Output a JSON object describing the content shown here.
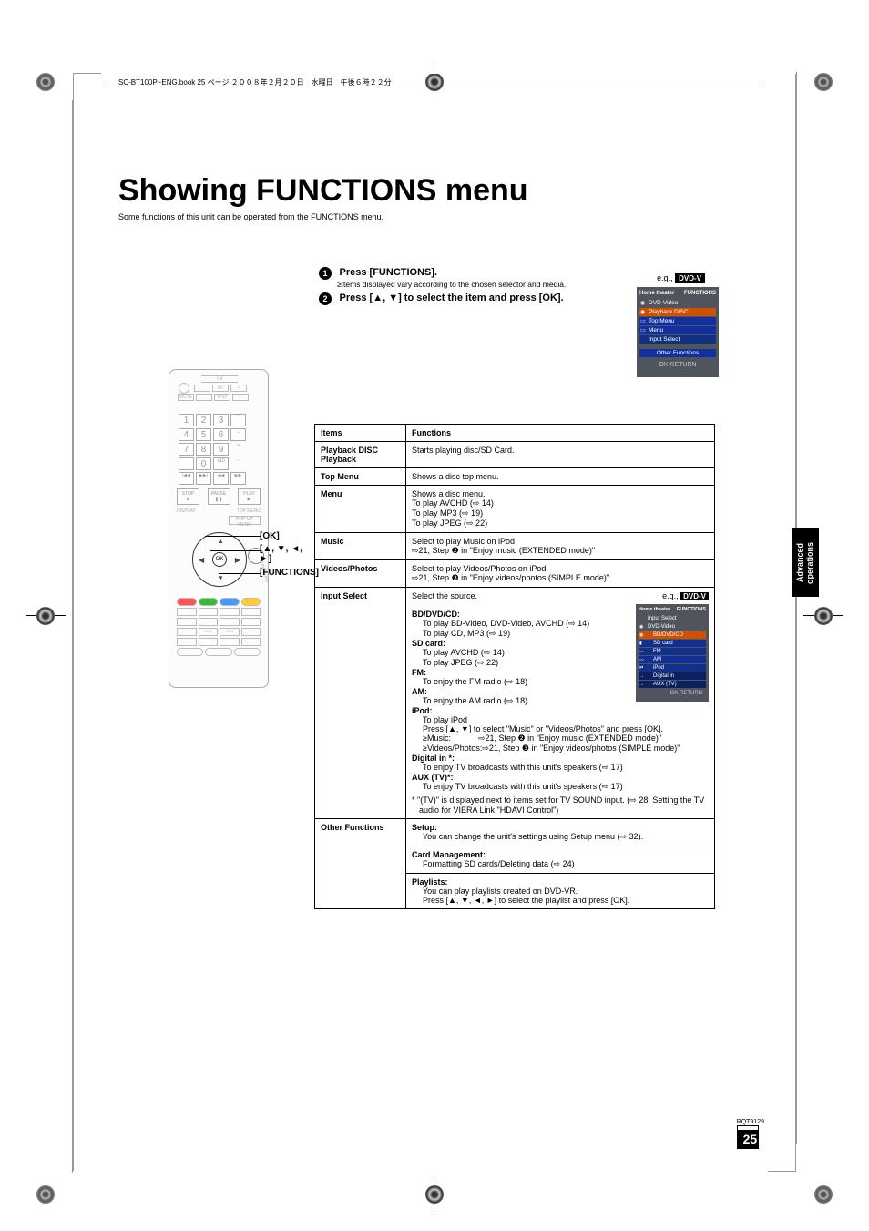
{
  "header_line": "SC-BT100P~ENG.book  25 ページ  ２００８年２月２０日　水曜日　午後６時２２分",
  "title": "Showing FUNCTIONS menu",
  "subtitle": "Some functions of this unit can be operated from the FUNCTIONS menu.",
  "steps": [
    {
      "num": "1",
      "text": "Press [FUNCTIONS].",
      "note": "≥Items displayed vary according to the chosen selector and media."
    },
    {
      "num": "2",
      "text": "Press [▲, ▼] to select the item and press [OK].",
      "note": ""
    }
  ],
  "eg_prefix": "e.g., ",
  "eg_label": "DVD-V",
  "osd1": {
    "left": "Home theater",
    "right": "FUNCTIONS",
    "title": "DVD-Video",
    "items": [
      "Playback DISC",
      "Top Menu",
      "Menu",
      "Input Select"
    ],
    "other": "Other Functions",
    "foot": "OK RETURN"
  },
  "remote_labels": {
    "ok": "[OK]",
    "arrows": "[▲, ▼, ◄, ►]",
    "functions": "[FUNCTIONS]"
  },
  "table": {
    "head": [
      "Items",
      "Functions"
    ],
    "rows": [
      {
        "item": "Playback DISC\nPlayback",
        "func": "Starts playing disc/SD Card."
      },
      {
        "item": "Top Menu",
        "func": "Shows a disc top menu."
      },
      {
        "item": "Menu",
        "func_lines": [
          "Shows a disc menu.",
          "To play AVCHD (⇨ 14)",
          "To play MP3 (⇨ 19)",
          "To play JPEG (⇨ 22)"
        ]
      },
      {
        "item": "Music",
        "func_lines": [
          "Select to play Music on iPod",
          "⇨21, Step ❷ in \"Enjoy music (EXTENDED mode)\""
        ]
      },
      {
        "item": "Videos/Photos",
        "func_lines": [
          "Select to play Videos/Photos on iPod",
          "⇨21, Step ❸ in \"Enjoy videos/photos (SIMPLE mode)\""
        ]
      },
      {
        "item": "Input Select",
        "selectline": "Select the source.",
        "eg": "e.g., ",
        "eglabel": "DVD-V",
        "osd2": {
          "left": "Home theater",
          "right": "FUNCTIONS",
          "title": "Input Select",
          "sub": "DVD-Video",
          "items": [
            "BD/DVD/CD",
            "SD card",
            "FM",
            "AM",
            "iPod",
            "Digital in",
            "AUX (TV)"
          ],
          "foot": "OK RETURN"
        },
        "groups": [
          {
            "head": "BD/DVD/CD:",
            "lines": [
              "To play BD-Video, DVD-Video, AVCHD (⇨ 14)",
              "To play CD, MP3 (⇨ 19)"
            ]
          },
          {
            "head": "SD card:",
            "lines": [
              "To play AVCHD (⇨ 14)",
              "To play JPEG (⇨ 22)"
            ]
          },
          {
            "head": "FM:",
            "lines": [
              "To enjoy the FM radio (⇨ 18)"
            ]
          },
          {
            "head": "AM:",
            "lines": [
              "To enjoy the AM radio (⇨ 18)"
            ]
          },
          {
            "head": "iPod:",
            "lines": [
              "To play iPod",
              "Press [▲, ▼] to select \"Music\" or \"Videos/Photos\" and press [OK].",
              "≥Music:            ⇨21, Step ❷ in \"Enjoy music (EXTENDED mode)\"",
              "≥Videos/Photos:⇨21, Step ❸ in \"Enjoy videos/photos (SIMPLE mode)\""
            ]
          },
          {
            "head": "Digital in *:",
            "lines": [
              "To enjoy TV broadcasts with this unit's speakers (⇨ 17)"
            ]
          },
          {
            "head": "AUX (TV)*:",
            "lines": [
              "To enjoy TV broadcasts with this unit's speakers (⇨ 17)"
            ]
          }
        ],
        "footnote": "* \"(TV)\" is displayed next to items set for TV SOUND input. (⇨ 28, Setting the TV audio for VIERA Link \"HDAVI Control\")"
      },
      {
        "item": "Other Functions",
        "subrows": [
          {
            "head": "Setup:",
            "line": "You can change the unit's settings using Setup menu (⇨ 32)."
          },
          {
            "head": "Card Management:",
            "line": "Formatting SD cards/Deleting data (⇨ 24)"
          },
          {
            "head": "Playlists:",
            "line": "You can play playlists created on DVD-VR.\nPress [▲, ▼, ◄, ►] to select the playlist and press [OK]."
          }
        ]
      }
    ]
  },
  "sidebar": "Advanced operations",
  "footer": {
    "rqt": "RQT9129",
    "page": "25"
  },
  "remote_tv": "TV"
}
